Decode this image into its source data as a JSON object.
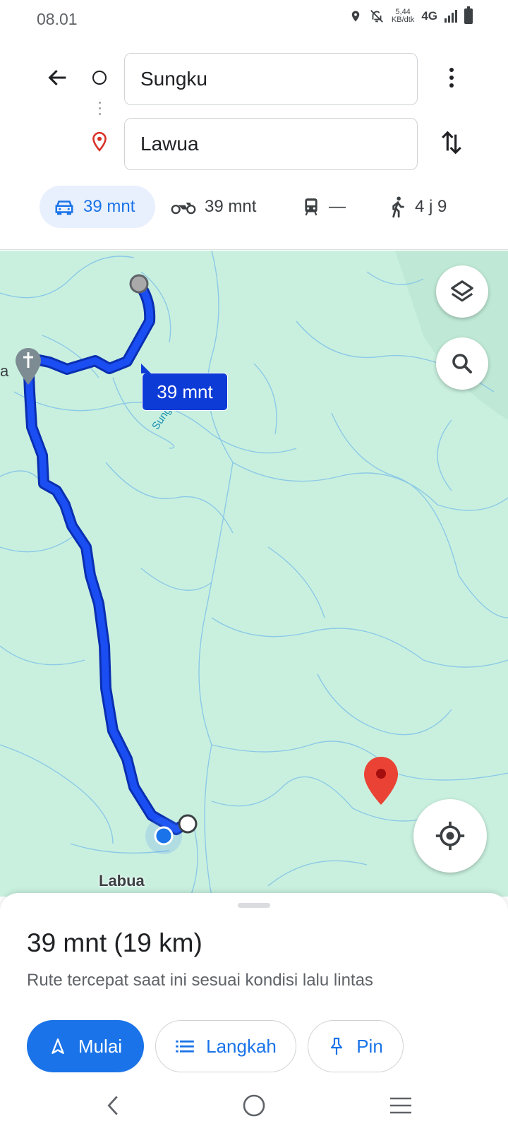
{
  "status": {
    "time": "08.01",
    "net_speed_value": "5,44",
    "net_speed_unit": "KB/dtk",
    "network": "4G"
  },
  "directions": {
    "origin": "Sungku",
    "destination": "Lawua"
  },
  "modes": {
    "car": "39 mnt",
    "motorcycle": "39 mnt",
    "transit": "—",
    "walk": "4 j 9"
  },
  "map": {
    "route_time_label": "39 mnt",
    "place_label": "Labua",
    "river_label": "Sungai la",
    "edge_label": "a"
  },
  "sheet": {
    "summary": "39 mnt (19 km)",
    "description": "Rute tercepat saat ini sesuai kondisi lalu lintas",
    "start_label": "Mulai",
    "steps_label": "Langkah",
    "pin_label": "Pin"
  },
  "colors": {
    "accent": "#1a73e8",
    "route": "#0d3bd6",
    "map_land": "#c9f0df",
    "destination_pin": "#ea4335"
  }
}
